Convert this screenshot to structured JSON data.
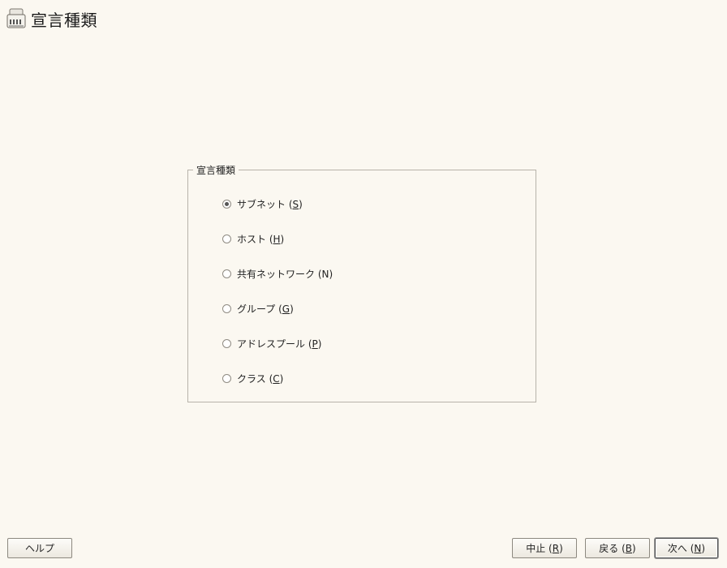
{
  "header": {
    "title": "宣言種類",
    "icon": "network-card-icon"
  },
  "group": {
    "legend": "宣言種類",
    "options": [
      {
        "text": "サブネット (",
        "key": "S",
        "close": ")",
        "checked": true
      },
      {
        "text": "ホスト (",
        "key": "H",
        "close": ")",
        "checked": false
      },
      {
        "text": "共有ネットワーク (N)",
        "key": "",
        "close": "",
        "checked": false
      },
      {
        "text": "グループ (",
        "key": "G",
        "close": ")",
        "checked": false
      },
      {
        "text": "アドレスプール (",
        "key": "P",
        "close": ")",
        "checked": false
      },
      {
        "text": "クラス (",
        "key": "C",
        "close": ")",
        "checked": false
      }
    ]
  },
  "buttons": {
    "help": "ヘルプ",
    "abort_text": "中止 (",
    "abort_key": "R",
    "back_text": "戻る (",
    "back_key": "B",
    "next_text": "次へ (",
    "next_key": "N",
    "close_paren": ")"
  }
}
